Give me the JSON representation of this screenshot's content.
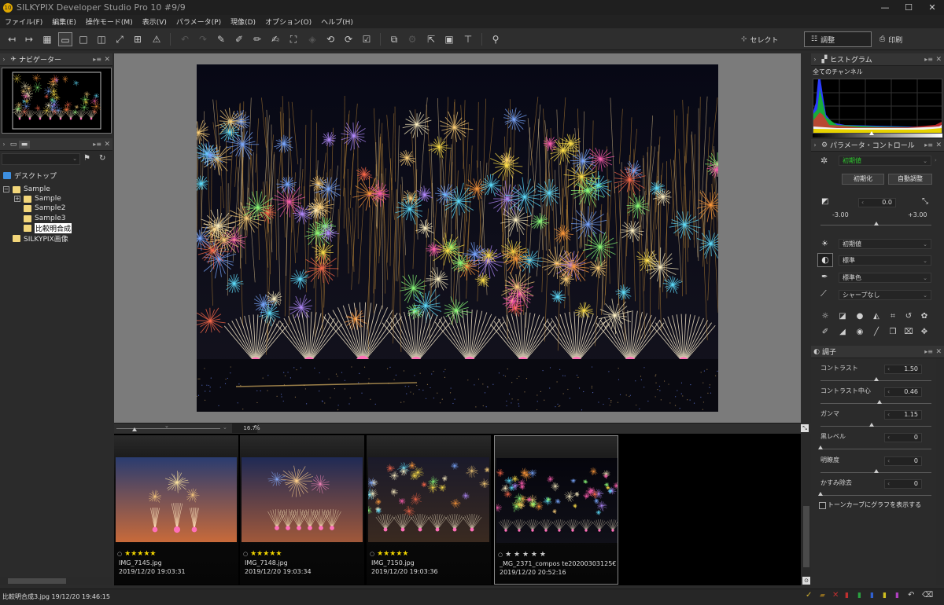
{
  "window": {
    "title": "SILKYPIX Developer Studio Pro 10   #9/9",
    "app_icon": "10"
  },
  "menu": [
    "ファイル(F)",
    "編集(E)",
    "操作モード(M)",
    "表示(V)",
    "パラメータ(P)",
    "現像(D)",
    "オプション(O)",
    "ヘルプ(H)"
  ],
  "modes": {
    "select": "セレクト",
    "adjust": "調整",
    "print": "印刷"
  },
  "navigator": {
    "title": "ナビゲーター"
  },
  "folders": {
    "desktop": "デスクトップ",
    "sample_root": "Sample",
    "sample": "Sample",
    "sample2": "Sample2",
    "sample3": "Sample3",
    "selected": "比較明合成",
    "silkypix": "SILKYPIX画像"
  },
  "zoom": {
    "value": "16.7",
    "unit": "%"
  },
  "thumbnails": [
    {
      "name": "IMG_7145.jpg",
      "date": "2019/12/20 19:03:31",
      "rating": 5
    },
    {
      "name": "IMG_7148.jpg",
      "date": "2019/12/20 19:03:34",
      "rating": 5
    },
    {
      "name": "IMG_7150.jpg",
      "date": "2019/12/20 19:03:36",
      "rating": 5
    },
    {
      "name": "_MG_2371_compos te20200303125€",
      "date": "2019/12/20 20:52:16",
      "rating": 0
    }
  ],
  "histogram": {
    "title": "ヒストグラム",
    "channel": "全てのチャンネル"
  },
  "params": {
    "title": "パラメータ・コントロール",
    "preset": "初期値",
    "init_btn": "初期化",
    "auto_btn": "自動調整",
    "exposure_value": "0.0",
    "exposure_min": "-3.00",
    "exposure_max": "+3.00",
    "wb": "初期値",
    "tone": "標準",
    "color": "標準色",
    "sharp": "シャープなし"
  },
  "tone_panel": {
    "title": "調子",
    "sliders": [
      {
        "label": "コントラスト",
        "value": "1.50",
        "level": 0.5
      },
      {
        "label": "コントラスト中心",
        "value": "0.46",
        "level": 0.53
      },
      {
        "label": "ガンマ",
        "value": "1.15",
        "level": 0.46
      },
      {
        "label": "黒レベル",
        "value": "0",
        "level": 0.0
      },
      {
        "label": "明瞭度",
        "value": "0",
        "level": 0.5
      },
      {
        "label": "かすみ除去",
        "value": "0",
        "level": 0.0
      }
    ],
    "tone_curve_checkbox": "トーンカーブにグラフを表示する"
  },
  "status": {
    "text": "比較明合成3.jpg 19/12/20 19:46:15"
  }
}
